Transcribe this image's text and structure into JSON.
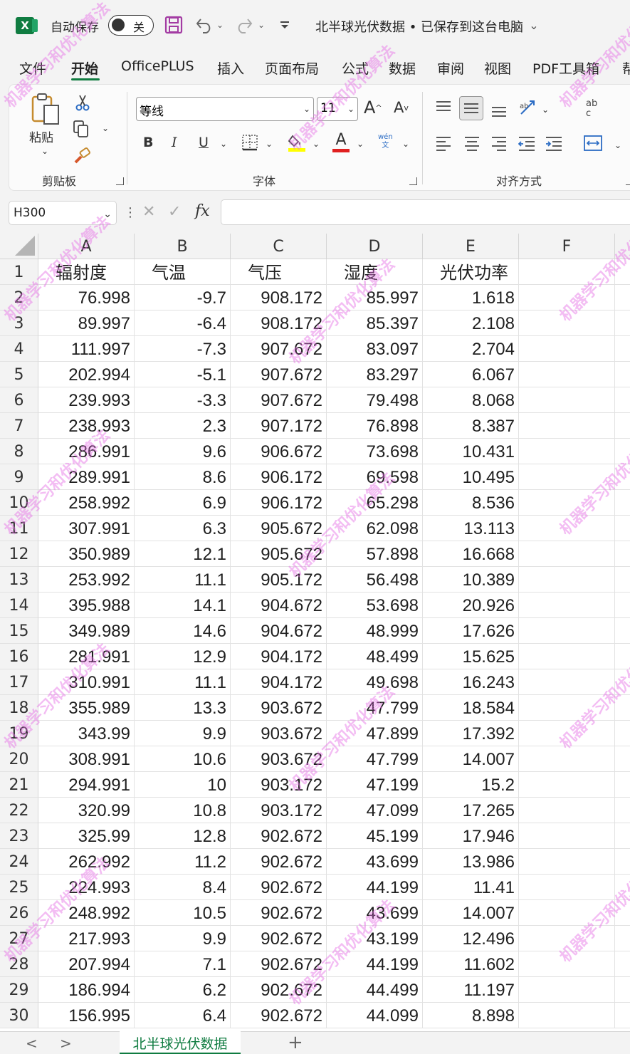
{
  "titlebar": {
    "app_logo": "X",
    "autosave_label": "自动保存",
    "autosave_state": "关",
    "doc_title": "北半球光伏数据 • 已保存到这台电脑",
    "icons": [
      "save-icon",
      "undo-icon",
      "redo-icon",
      "customize-qat-icon",
      "chevron-down-icon"
    ]
  },
  "tabs": [
    "文件",
    "开始",
    "OfficePLUS",
    "插入",
    "页面布局",
    "公式",
    "数据",
    "审阅",
    "视图",
    "PDF工具箱",
    "帮"
  ],
  "active_tab": "开始",
  "ribbon": {
    "clipboard": {
      "paste_label": "粘贴",
      "group_label": "剪贴板"
    },
    "font": {
      "font_name": "等线",
      "font_size": "11",
      "group_label": "字体",
      "bold": "B",
      "italic": "I",
      "underline": "U",
      "grow": "A",
      "shrink": "A",
      "font_color": "A",
      "phonetic": "wén\n文"
    },
    "alignment": {
      "group_label": "对齐方式",
      "wrap": "ab\nc"
    }
  },
  "formula_bar": {
    "name_box": "H300",
    "fx_label": "fx",
    "formula": ""
  },
  "sheet": {
    "columns": [
      "A",
      "B",
      "C",
      "D",
      "E",
      "F"
    ],
    "headers": [
      "辐射度",
      "气温",
      "气压",
      "湿度",
      "光伏功率"
    ],
    "rows": [
      [
        "76.998",
        "-9.7",
        "908.172",
        "85.997",
        "1.618"
      ],
      [
        "89.997",
        "-6.4",
        "908.172",
        "85.397",
        "2.108"
      ],
      [
        "111.997",
        "-7.3",
        "907.672",
        "83.097",
        "2.704"
      ],
      [
        "202.994",
        "-5.1",
        "907.672",
        "83.297",
        "6.067"
      ],
      [
        "239.993",
        "-3.3",
        "907.672",
        "79.498",
        "8.068"
      ],
      [
        "238.993",
        "2.3",
        "907.172",
        "76.898",
        "8.387"
      ],
      [
        "286.991",
        "9.6",
        "906.672",
        "73.698",
        "10.431"
      ],
      [
        "289.991",
        "8.6",
        "906.172",
        "69.598",
        "10.495"
      ],
      [
        "258.992",
        "6.9",
        "906.172",
        "65.298",
        "8.536"
      ],
      [
        "307.991",
        "6.3",
        "905.672",
        "62.098",
        "13.113"
      ],
      [
        "350.989",
        "12.1",
        "905.672",
        "57.898",
        "16.668"
      ],
      [
        "253.992",
        "11.1",
        "905.172",
        "56.498",
        "10.389"
      ],
      [
        "395.988",
        "14.1",
        "904.672",
        "53.698",
        "20.926"
      ],
      [
        "349.989",
        "14.6",
        "904.672",
        "48.999",
        "17.626"
      ],
      [
        "281.991",
        "12.9",
        "904.172",
        "48.499",
        "15.625"
      ],
      [
        "310.991",
        "11.1",
        "904.172",
        "49.698",
        "16.243"
      ],
      [
        "355.989",
        "13.3",
        "903.672",
        "47.799",
        "18.584"
      ],
      [
        "343.99",
        "9.9",
        "903.672",
        "47.899",
        "17.392"
      ],
      [
        "308.991",
        "10.6",
        "903.672",
        "47.799",
        "14.007"
      ],
      [
        "294.991",
        "10",
        "903.172",
        "47.199",
        "15.2"
      ],
      [
        "320.99",
        "10.8",
        "903.172",
        "47.099",
        "17.265"
      ],
      [
        "325.99",
        "12.8",
        "902.672",
        "45.199",
        "17.946"
      ],
      [
        "262.992",
        "11.2",
        "902.672",
        "43.699",
        "13.986"
      ],
      [
        "224.993",
        "8.4",
        "902.672",
        "44.199",
        "11.41"
      ],
      [
        "248.992",
        "10.5",
        "902.672",
        "43.699",
        "14.007"
      ],
      [
        "217.993",
        "9.9",
        "902.672",
        "43.199",
        "12.496"
      ],
      [
        "207.994",
        "7.1",
        "902.672",
        "44.199",
        "11.602"
      ],
      [
        "186.994",
        "6.2",
        "902.672",
        "44.499",
        "11.197"
      ],
      [
        "156.995",
        "6.4",
        "902.672",
        "44.099",
        "8.898"
      ]
    ]
  },
  "sheet_tabs": {
    "active": "北半球光伏数据",
    "add": "+",
    "prev": "<",
    "next": ">"
  },
  "watermark": "机器学习和优化算法",
  "colors": {
    "accent": "#107c41",
    "watermark": "#e66ee6"
  }
}
